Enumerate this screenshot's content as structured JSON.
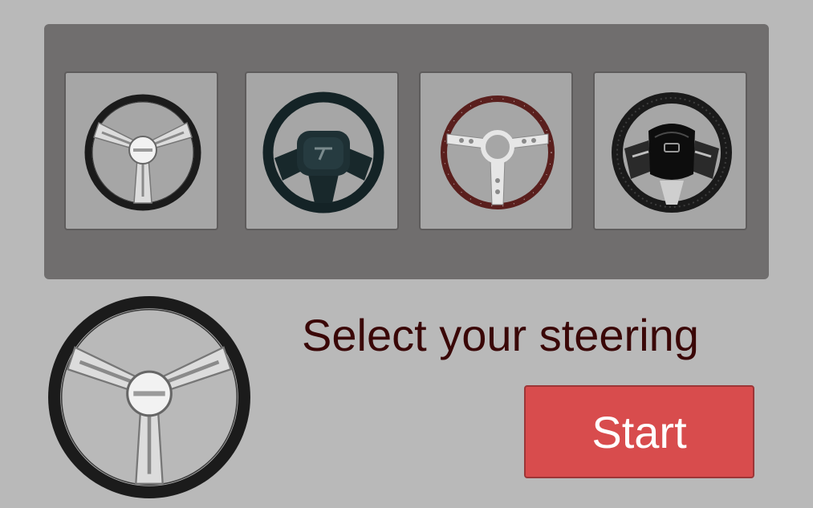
{
  "heading": "Select your steering",
  "start_label": "Start",
  "colors": {
    "background": "#b9b9b9",
    "panel": "#706e6e",
    "slot": "#a6a6a6",
    "heading_text": "#3a0707",
    "start_button": "#d84c4d",
    "start_text": "#ffffff"
  },
  "steering_options": [
    {
      "icon": "chrome-three-spoke-wheel-icon"
    },
    {
      "icon": "black-airbag-wheel-icon"
    },
    {
      "icon": "wood-rim-three-spoke-wheel-icon"
    },
    {
      "icon": "sport-multifunction-wheel-icon"
    }
  ],
  "selected_preview": {
    "icon": "chrome-three-spoke-wheel-icon"
  }
}
